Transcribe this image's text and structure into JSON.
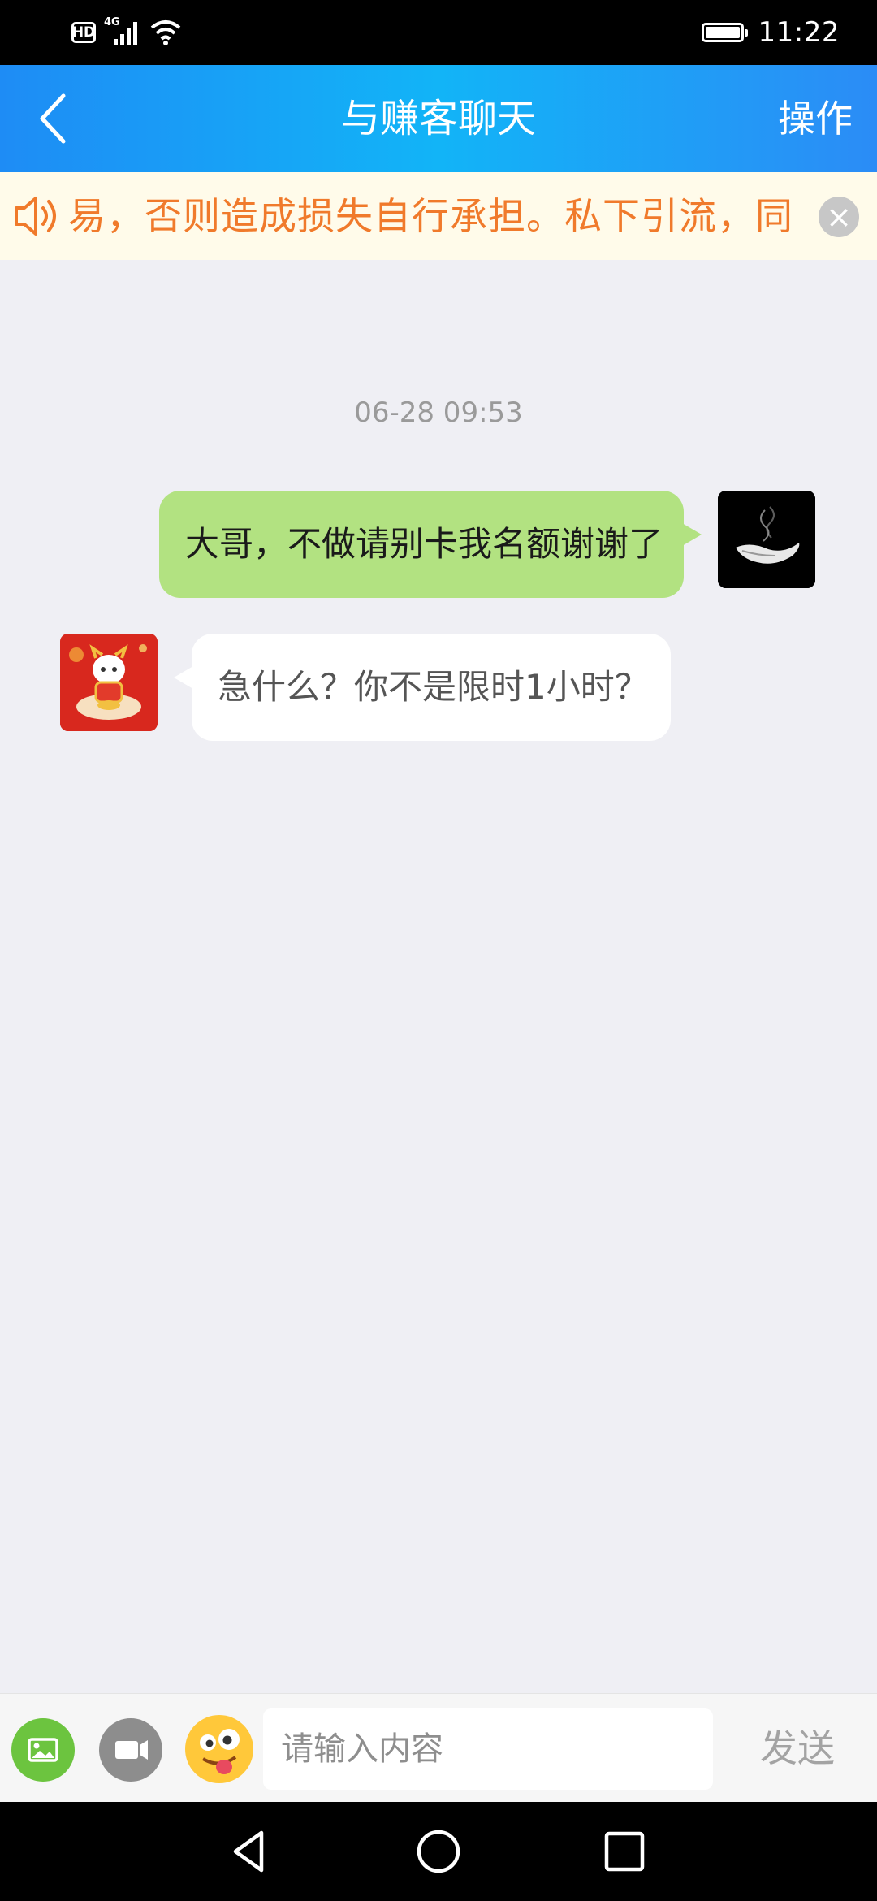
{
  "status_bar": {
    "hd_label": "HD",
    "network": "4G",
    "time": "11:22"
  },
  "header": {
    "title": "与赚客聊天",
    "action_label": "操作"
  },
  "notice": {
    "text": "易，否则造成损失自行承担。私下引流，同",
    "accent_color": "#f07a2b"
  },
  "chat": {
    "timestamp": "06-28 09:53",
    "messages": [
      {
        "side": "right",
        "text": "大哥，不做请别卡我名额谢谢了"
      },
      {
        "side": "left",
        "text": "急什么？你不是限时1小时？"
      }
    ]
  },
  "input_bar": {
    "placeholder": "请输入内容",
    "value": "",
    "send_label": "发送",
    "icons": [
      "image-icon",
      "video-icon",
      "emoji-icon"
    ]
  },
  "colors": {
    "nav_gradient": [
      "#1e8cf5",
      "#12b4f7",
      "#2b8cf6"
    ],
    "outgoing_bubble": "#b2e281",
    "incoming_bubble": "#ffffff",
    "background": "#efeff4"
  }
}
